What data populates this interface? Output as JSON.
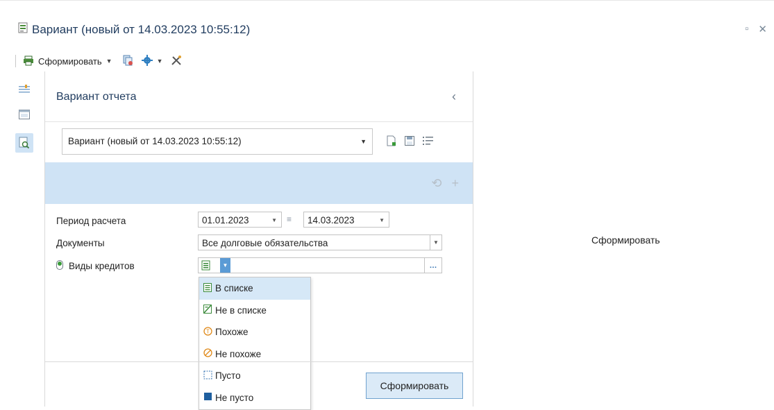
{
  "window": {
    "title": "Вариант (новый от 14.03.2023 10:55:12)"
  },
  "toolbar": {
    "form_label": "Сформировать"
  },
  "panel": {
    "title": "Вариант отчета",
    "variant_select_value": "Вариант (новый от 14.03.2023 10:55:12)"
  },
  "params": {
    "period_label": "Период расчета",
    "period_from": "01.01.2023",
    "period_to": "14.03.2023",
    "documents_label": "Документы",
    "documents_value": "Все долговые обязательства",
    "credit_types_label": "Виды кредитов"
  },
  "dropdown": {
    "items": [
      {
        "label": "В списке",
        "icon": "in-list-icon",
        "selected": true
      },
      {
        "label": "Не в списке",
        "icon": "not-in-list-icon",
        "selected": false
      },
      {
        "label": "Похоже",
        "icon": "like-icon",
        "selected": false
      },
      {
        "label": "Не похоже",
        "icon": "not-like-icon",
        "selected": false
      },
      {
        "label": "Пусто",
        "icon": "empty-icon",
        "selected": false
      },
      {
        "label": "Не пусто",
        "icon": "not-empty-icon",
        "selected": false
      }
    ]
  },
  "footer": {
    "form_button": "Сформировать"
  },
  "preview": {
    "label": "Сформировать"
  },
  "colors": {
    "accent": "#cfe3f5",
    "title": "#1f3b5e",
    "button_border": "#6fa2cf"
  }
}
